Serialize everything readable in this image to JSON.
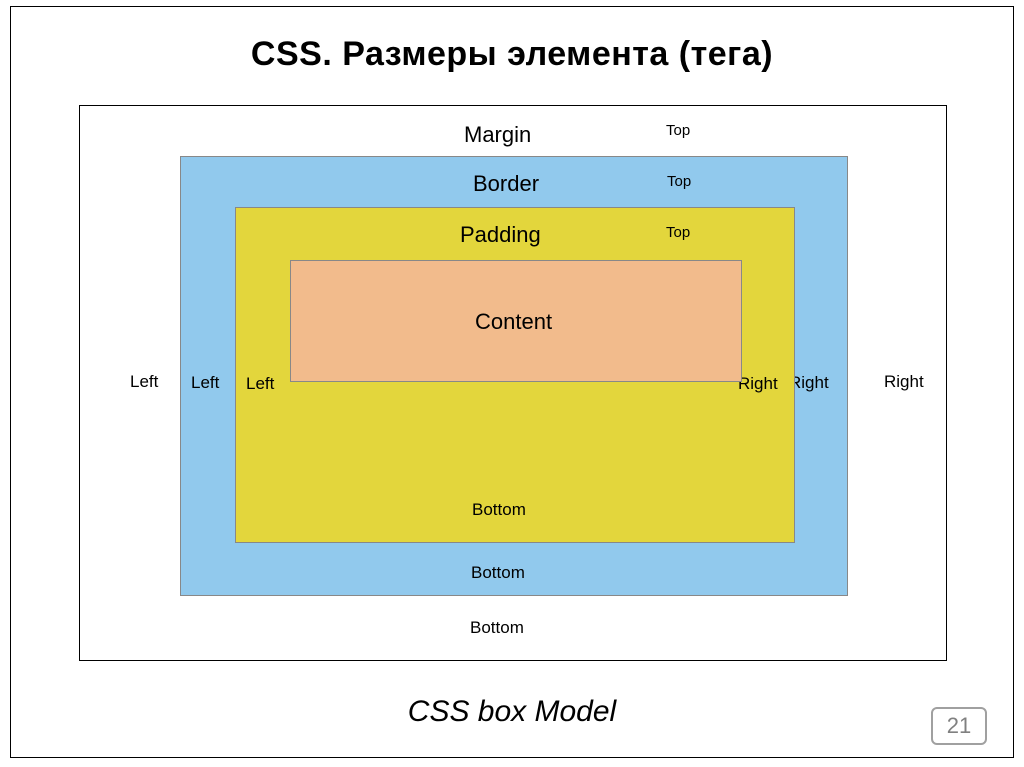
{
  "title": "CSS. Размеры элемента (тега)",
  "caption": "CSS box Model",
  "page_number": "21",
  "boxmodel": {
    "margin": {
      "name": "Margin",
      "top": "Top",
      "right": "Right",
      "bottom": "Bottom",
      "left": "Left"
    },
    "border": {
      "name": "Border",
      "top": "Top",
      "right": "Right",
      "bottom": "Bottom",
      "left": "Left"
    },
    "padding": {
      "name": "Padding",
      "top": "Top",
      "right": "Right",
      "bottom": "Bottom",
      "left": "Left"
    },
    "content": {
      "name": "Content"
    }
  },
  "colors": {
    "border_layer": "#91c9ed",
    "padding_layer": "#e3d63c",
    "content_layer": "#f2bb8c",
    "margin_layer": "#ffffff"
  }
}
